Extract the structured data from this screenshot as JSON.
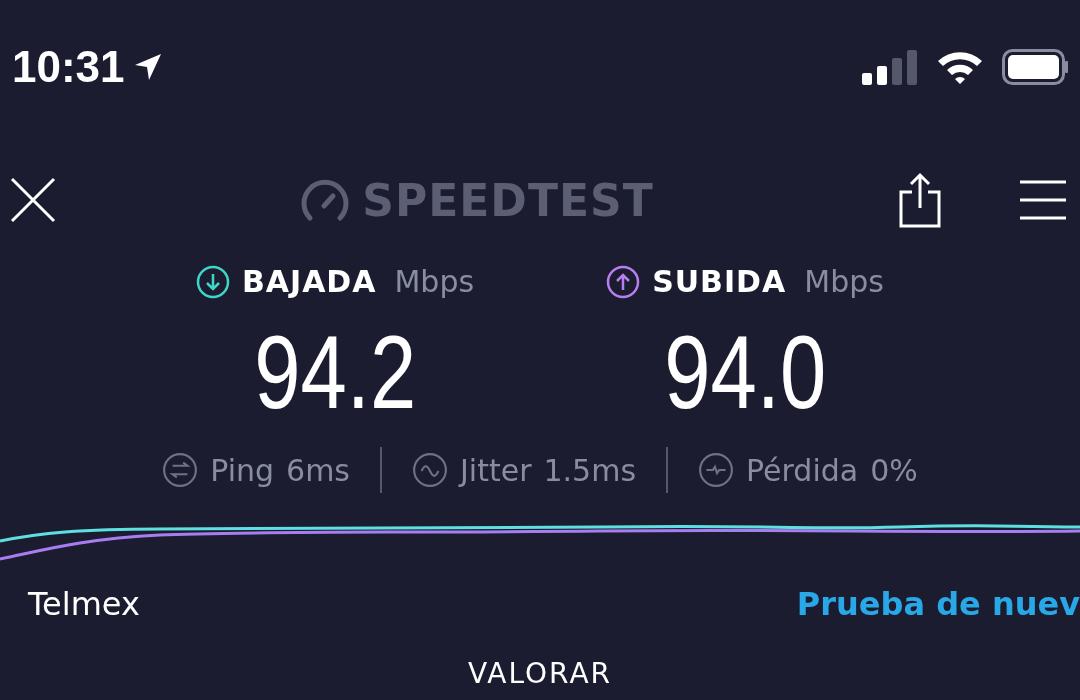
{
  "status_bar": {
    "time": "10:31"
  },
  "header": {
    "logo": "SPEEDTEST"
  },
  "results": [
    {
      "kind": "download",
      "label": "BAJADA",
      "unit": "Mbps",
      "value": "94.2"
    },
    {
      "kind": "upload",
      "label": "SUBIDA",
      "unit": "Mbps",
      "value": "94.0"
    }
  ],
  "stats": [
    {
      "kind": "ping",
      "label": "Ping",
      "value": "6ms"
    },
    {
      "kind": "jitter",
      "label": "Jitter",
      "value": "1.5ms"
    },
    {
      "kind": "loss",
      "label": "Pérdida",
      "value": "0%"
    }
  ],
  "provider": "Telmex",
  "retest_link": "Prueba de nuev",
  "rate_button": "VALORAR"
}
